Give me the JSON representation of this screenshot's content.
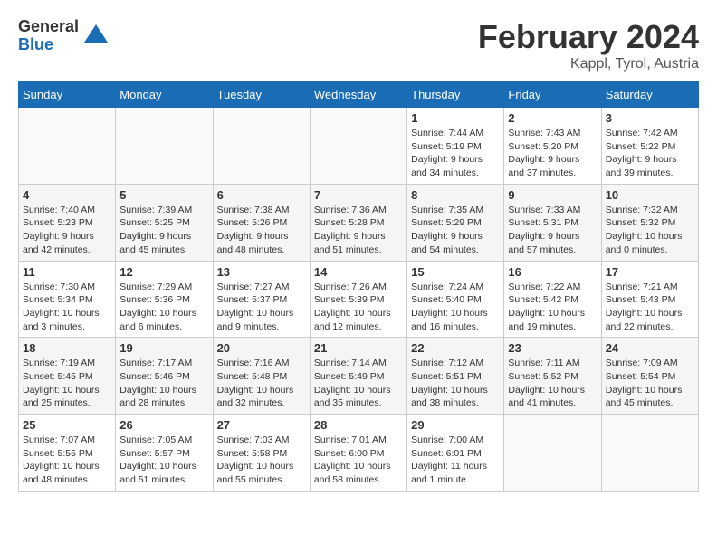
{
  "header": {
    "logo_general": "General",
    "logo_blue": "Blue",
    "month_title": "February 2024",
    "location": "Kappl, Tyrol, Austria"
  },
  "weekdays": [
    "Sunday",
    "Monday",
    "Tuesday",
    "Wednesday",
    "Thursday",
    "Friday",
    "Saturday"
  ],
  "weeks": [
    [
      {
        "day": "",
        "info": ""
      },
      {
        "day": "",
        "info": ""
      },
      {
        "day": "",
        "info": ""
      },
      {
        "day": "",
        "info": ""
      },
      {
        "day": "1",
        "info": "Sunrise: 7:44 AM\nSunset: 5:19 PM\nDaylight: 9 hours and 34 minutes."
      },
      {
        "day": "2",
        "info": "Sunrise: 7:43 AM\nSunset: 5:20 PM\nDaylight: 9 hours and 37 minutes."
      },
      {
        "day": "3",
        "info": "Sunrise: 7:42 AM\nSunset: 5:22 PM\nDaylight: 9 hours and 39 minutes."
      }
    ],
    [
      {
        "day": "4",
        "info": "Sunrise: 7:40 AM\nSunset: 5:23 PM\nDaylight: 9 hours and 42 minutes."
      },
      {
        "day": "5",
        "info": "Sunrise: 7:39 AM\nSunset: 5:25 PM\nDaylight: 9 hours and 45 minutes."
      },
      {
        "day": "6",
        "info": "Sunrise: 7:38 AM\nSunset: 5:26 PM\nDaylight: 9 hours and 48 minutes."
      },
      {
        "day": "7",
        "info": "Sunrise: 7:36 AM\nSunset: 5:28 PM\nDaylight: 9 hours and 51 minutes."
      },
      {
        "day": "8",
        "info": "Sunrise: 7:35 AM\nSunset: 5:29 PM\nDaylight: 9 hours and 54 minutes."
      },
      {
        "day": "9",
        "info": "Sunrise: 7:33 AM\nSunset: 5:31 PM\nDaylight: 9 hours and 57 minutes."
      },
      {
        "day": "10",
        "info": "Sunrise: 7:32 AM\nSunset: 5:32 PM\nDaylight: 10 hours and 0 minutes."
      }
    ],
    [
      {
        "day": "11",
        "info": "Sunrise: 7:30 AM\nSunset: 5:34 PM\nDaylight: 10 hours and 3 minutes."
      },
      {
        "day": "12",
        "info": "Sunrise: 7:29 AM\nSunset: 5:36 PM\nDaylight: 10 hours and 6 minutes."
      },
      {
        "day": "13",
        "info": "Sunrise: 7:27 AM\nSunset: 5:37 PM\nDaylight: 10 hours and 9 minutes."
      },
      {
        "day": "14",
        "info": "Sunrise: 7:26 AM\nSunset: 5:39 PM\nDaylight: 10 hours and 12 minutes."
      },
      {
        "day": "15",
        "info": "Sunrise: 7:24 AM\nSunset: 5:40 PM\nDaylight: 10 hours and 16 minutes."
      },
      {
        "day": "16",
        "info": "Sunrise: 7:22 AM\nSunset: 5:42 PM\nDaylight: 10 hours and 19 minutes."
      },
      {
        "day": "17",
        "info": "Sunrise: 7:21 AM\nSunset: 5:43 PM\nDaylight: 10 hours and 22 minutes."
      }
    ],
    [
      {
        "day": "18",
        "info": "Sunrise: 7:19 AM\nSunset: 5:45 PM\nDaylight: 10 hours and 25 minutes."
      },
      {
        "day": "19",
        "info": "Sunrise: 7:17 AM\nSunset: 5:46 PM\nDaylight: 10 hours and 28 minutes."
      },
      {
        "day": "20",
        "info": "Sunrise: 7:16 AM\nSunset: 5:48 PM\nDaylight: 10 hours and 32 minutes."
      },
      {
        "day": "21",
        "info": "Sunrise: 7:14 AM\nSunset: 5:49 PM\nDaylight: 10 hours and 35 minutes."
      },
      {
        "day": "22",
        "info": "Sunrise: 7:12 AM\nSunset: 5:51 PM\nDaylight: 10 hours and 38 minutes."
      },
      {
        "day": "23",
        "info": "Sunrise: 7:11 AM\nSunset: 5:52 PM\nDaylight: 10 hours and 41 minutes."
      },
      {
        "day": "24",
        "info": "Sunrise: 7:09 AM\nSunset: 5:54 PM\nDaylight: 10 hours and 45 minutes."
      }
    ],
    [
      {
        "day": "25",
        "info": "Sunrise: 7:07 AM\nSunset: 5:55 PM\nDaylight: 10 hours and 48 minutes."
      },
      {
        "day": "26",
        "info": "Sunrise: 7:05 AM\nSunset: 5:57 PM\nDaylight: 10 hours and 51 minutes."
      },
      {
        "day": "27",
        "info": "Sunrise: 7:03 AM\nSunset: 5:58 PM\nDaylight: 10 hours and 55 minutes."
      },
      {
        "day": "28",
        "info": "Sunrise: 7:01 AM\nSunset: 6:00 PM\nDaylight: 10 hours and 58 minutes."
      },
      {
        "day": "29",
        "info": "Sunrise: 7:00 AM\nSunset: 6:01 PM\nDaylight: 11 hours and 1 minute."
      },
      {
        "day": "",
        "info": ""
      },
      {
        "day": "",
        "info": ""
      }
    ]
  ]
}
